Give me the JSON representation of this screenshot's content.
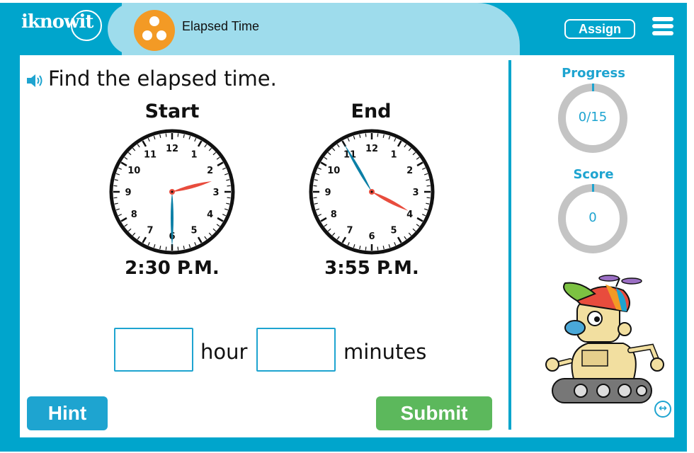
{
  "header": {
    "logo": "iknowit",
    "topic_title": "Elapsed Time",
    "topic_icon": "three-dots-icon",
    "assign_label": "Assign",
    "menu_icon": "hamburger-menu-icon"
  },
  "question": {
    "audio_icon": "speaker-icon",
    "text": "Find the elapsed time."
  },
  "clocks": [
    {
      "label": "Start",
      "time": "2:30 P.M.",
      "hour": 2,
      "minute": 30
    },
    {
      "label": "End",
      "time": "3:55 P.M.",
      "hour": 3,
      "minute": 55
    }
  ],
  "clock_numbers": [
    "12",
    "1",
    "2",
    "3",
    "4",
    "5",
    "6",
    "7",
    "8",
    "9",
    "10",
    "11"
  ],
  "answer": {
    "hour_value": "",
    "hour_unit": "hour",
    "minutes_value": "",
    "minutes_unit": "minutes"
  },
  "buttons": {
    "hint": "Hint",
    "submit": "Submit"
  },
  "sidebar": {
    "progress_label": "Progress",
    "progress_value": "0/15",
    "score_label": "Score",
    "score_value": "0",
    "swap_icon": "swap-arrows-icon"
  },
  "colors": {
    "brand": "#00a5cc",
    "accent": "#1ea4d0",
    "topic": "#f39a25",
    "submit": "#5cb85c",
    "minute_hand": "#0b7fa6",
    "hour_hand": "#e84c3d"
  }
}
